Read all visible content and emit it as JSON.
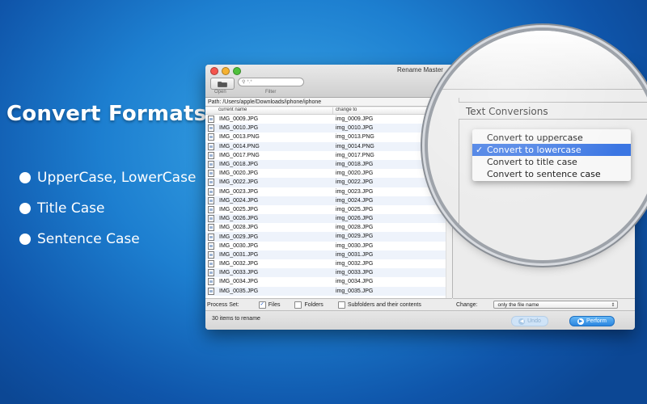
{
  "promo": {
    "title": "Convert Formats to",
    "features": [
      "UpperCase, LowerCase",
      "Title Case",
      "Sentence Case"
    ]
  },
  "window": {
    "title": "Rename Master",
    "toolbar": {
      "open_label": "Open",
      "filter_label": "Filter",
      "filter_placeholder": "*.*"
    },
    "path_label": "Path:",
    "path_value": "/Users/apple/Downloads/iphone/iphone",
    "columns": {
      "current": "current name",
      "change": "change to"
    },
    "rows": [
      {
        "current": "IMG_0009.JPG",
        "change": "img_0009.JPG"
      },
      {
        "current": "IMG_0010.JPG",
        "change": "img_0010.JPG"
      },
      {
        "current": "IMG_0013.PNG",
        "change": "img_0013.PNG"
      },
      {
        "current": "IMG_0014.PNG",
        "change": "img_0014.PNG"
      },
      {
        "current": "IMG_0017.PNG",
        "change": "img_0017.PNG"
      },
      {
        "current": "IMG_0018.JPG",
        "change": "img_0018.JPG"
      },
      {
        "current": "IMG_0020.JPG",
        "change": "img_0020.JPG"
      },
      {
        "current": "IMG_0022.JPG",
        "change": "img_0022.JPG"
      },
      {
        "current": "IMG_0023.JPG",
        "change": "img_0023.JPG"
      },
      {
        "current": "IMG_0024.JPG",
        "change": "img_0024.JPG"
      },
      {
        "current": "IMG_0025.JPG",
        "change": "img_0025.JPG"
      },
      {
        "current": "IMG_0026.JPG",
        "change": "img_0026.JPG"
      },
      {
        "current": "IMG_0028.JPG",
        "change": "img_0028.JPG"
      },
      {
        "current": "IMG_0029.JPG",
        "change": "img_0029.JPG"
      },
      {
        "current": "IMG_0030.JPG",
        "change": "img_0030.JPG"
      },
      {
        "current": "IMG_0031.JPG",
        "change": "img_0031.JPG"
      },
      {
        "current": "IMG_0032.JPG",
        "change": "img_0032.JPG"
      },
      {
        "current": "IMG_0033.JPG",
        "change": "img_0033.JPG"
      },
      {
        "current": "IMG_0034.JPG",
        "change": "img_0034.JPG"
      },
      {
        "current": "IMG_0035.JPG",
        "change": "img_0035.JPG"
      }
    ],
    "process_set": {
      "label": "Process Set:",
      "files": {
        "label": "Files",
        "checked": true
      },
      "folders": {
        "label": "Folders",
        "checked": false
      },
      "subfolders": {
        "label": "Subfolders and their contents",
        "checked": false
      }
    },
    "change": {
      "label": "Change:",
      "value": "only the file name"
    },
    "status": "30 items to rename",
    "undo_label": "Undo",
    "perform_label": "Perform"
  },
  "magnifier": {
    "section_title": "Text Conversions",
    "menu": [
      {
        "label": "Convert to uppercase",
        "selected": false
      },
      {
        "label": "Convert to lowercase",
        "selected": true
      },
      {
        "label": "Convert to title case",
        "selected": false
      },
      {
        "label": "Convert to sentence case",
        "selected": false
      }
    ],
    "check_glyph": "✓"
  }
}
